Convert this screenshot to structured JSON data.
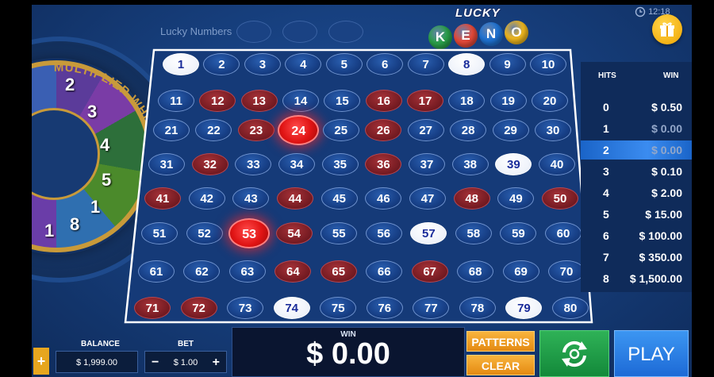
{
  "header": {
    "lucky_numbers_label": "Lucky Numbers",
    "logo_top": "LUCKY",
    "logo_letters": [
      "K",
      "E",
      "N",
      "O"
    ],
    "logo_ball_colors": [
      "#2aa14a",
      "#e84a3a",
      "#1f74d6",
      "#f2b91e"
    ],
    "clock_text": "12:18"
  },
  "wheel": {
    "title": "MULTIPLIER WHEEL",
    "numbers": [
      "2",
      "3",
      "4",
      "5",
      "1",
      "8",
      "1"
    ]
  },
  "board": {
    "numbers": [
      1,
      2,
      3,
      4,
      5,
      6,
      7,
      8,
      9,
      10,
      11,
      12,
      13,
      14,
      15,
      16,
      17,
      18,
      19,
      20,
      21,
      22,
      23,
      24,
      25,
      26,
      27,
      28,
      29,
      30,
      31,
      32,
      33,
      34,
      35,
      36,
      37,
      38,
      39,
      40,
      41,
      42,
      43,
      44,
      45,
      46,
      47,
      48,
      49,
      50,
      51,
      52,
      53,
      54,
      55,
      56,
      57,
      58,
      59,
      60,
      61,
      62,
      63,
      64,
      65,
      66,
      67,
      68,
      69,
      70,
      71,
      72,
      73,
      74,
      75,
      76,
      77,
      78,
      79,
      80
    ],
    "red_numbers": [
      12,
      13,
      16,
      17,
      23,
      26,
      32,
      36,
      41,
      44,
      48,
      50,
      54,
      64,
      65,
      67,
      71,
      72
    ],
    "white_numbers": [
      1,
      8,
      39,
      57,
      74,
      79
    ],
    "hit_numbers": [
      24,
      53
    ]
  },
  "paytable": {
    "hits_header": "HITS",
    "win_header": "WIN",
    "rows": [
      {
        "hits": "0",
        "win": "$ 0.50"
      },
      {
        "hits": "1",
        "win": "$ 0.00"
      },
      {
        "hits": "2",
        "win": "$ 0.00"
      },
      {
        "hits": "3",
        "win": "$ 0.10"
      },
      {
        "hits": "4",
        "win": "$ 2.00"
      },
      {
        "hits": "5",
        "win": "$ 15.00"
      },
      {
        "hits": "6",
        "win": "$ 100.00"
      },
      {
        "hits": "7",
        "win": "$ 350.00"
      },
      {
        "hits": "8",
        "win": "$ 1,500.00"
      }
    ],
    "active_row_index": 2
  },
  "bottom": {
    "plus_label": "+",
    "balance_label": "BALANCE",
    "balance_value": "$ 1,999.00",
    "bet_label": "BET",
    "bet_value": "$ 1.00",
    "bet_minus": "−",
    "bet_plus": "+",
    "win_label": "WIN",
    "win_value": "$ 0.00",
    "patterns_label": "PATTERNS",
    "clear_label": "CLEAR",
    "auto_icon": "autoplay-cycle-icon",
    "play_label": "PLAY"
  }
}
